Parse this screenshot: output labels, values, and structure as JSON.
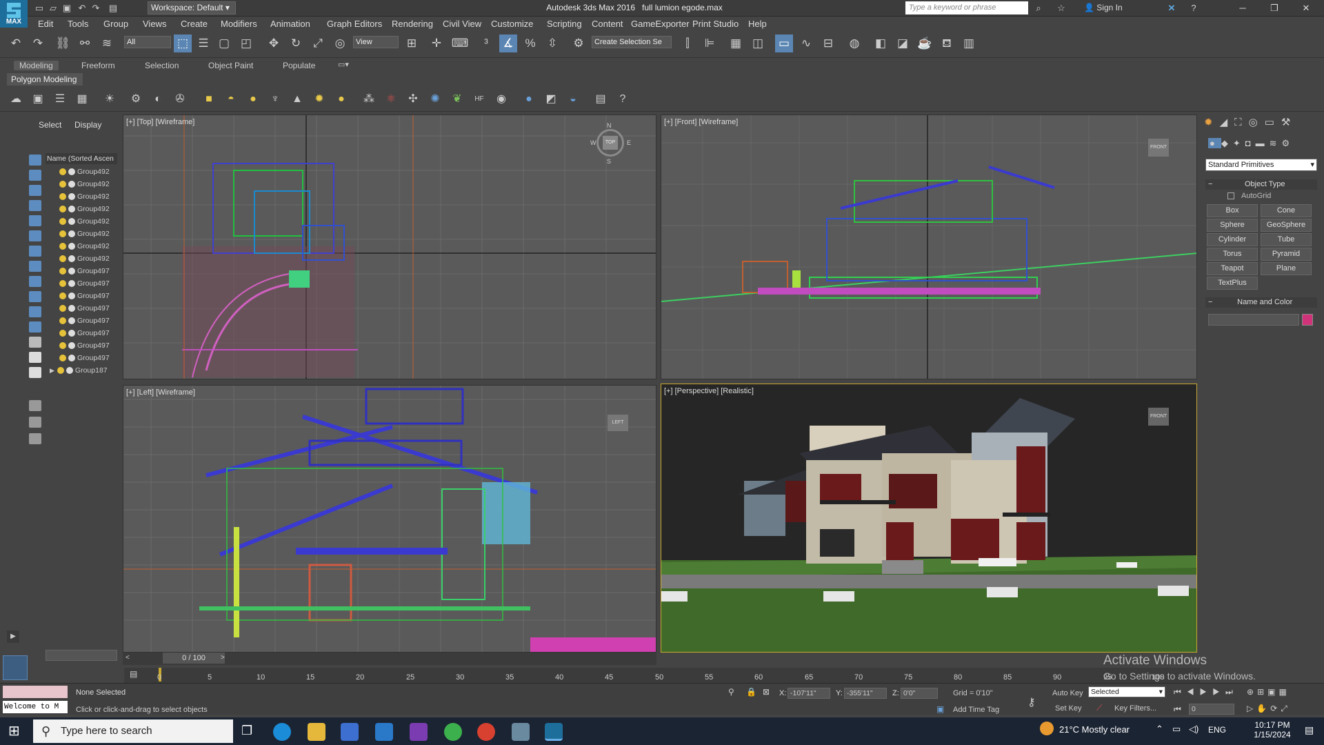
{
  "titlebar": {
    "workspace": "Workspace: Default",
    "app_title": "Autodesk 3ds Max 2016",
    "file_name": "full lumion egode.max",
    "search_placeholder": "Type a keyword or phrase",
    "sign_in": "Sign In",
    "logo_text": "MAX"
  },
  "menu": [
    "Edit",
    "Tools",
    "Group",
    "Views",
    "Create",
    "Modifiers",
    "Animation",
    "Graph Editors",
    "Rendering",
    "Civil View",
    "Customize",
    "Scripting",
    "Content",
    "GameExporter",
    "Print Studio",
    "Help"
  ],
  "main_toolbar": {
    "selection_filter": "All",
    "reference_coord": "View",
    "create_selection_set": "Create Selection Se"
  },
  "ribbon": {
    "tabs": [
      "Modeling",
      "Freeform",
      "Selection",
      "Object Paint",
      "Populate"
    ],
    "active_tab": "Modeling",
    "panel": "Polygon Modeling"
  },
  "scene_explorer": {
    "tabs": [
      "Select",
      "Display"
    ],
    "column": "Name (Sorted Ascen",
    "items": [
      "Group492",
      "Group492",
      "Group492",
      "Group492",
      "Group492",
      "Group492",
      "Group492",
      "Group492",
      "Group497",
      "Group497",
      "Group497",
      "Group497",
      "Group497",
      "Group497",
      "Group497",
      "Group497",
      "Group187"
    ]
  },
  "viewports": {
    "top": "[+] [Top] [Wireframe]",
    "front": "[+] [Front] [Wireframe]",
    "left": "[+] [Left] [Wireframe]",
    "perspective": "[+] [Perspective] [Realistic]",
    "viewcube_top": "TOP",
    "viewcube_front": "FRONT",
    "viewcube_left": "LEFT",
    "compass": [
      "N",
      "E",
      "S",
      "W"
    ]
  },
  "command_panel": {
    "category": "Standard Primitives",
    "object_type": "Object Type",
    "autogrid": "AutoGrid",
    "buttons": [
      "Box",
      "Cone",
      "Sphere",
      "GeoSphere",
      "Cylinder",
      "Tube",
      "Torus",
      "Pyramid",
      "Teapot",
      "Plane",
      "TextPlus"
    ],
    "name_and_color": "Name and Color",
    "color": "#d1337a"
  },
  "timeline": {
    "frame": "0 / 100",
    "ticks": [
      "0",
      "5",
      "10",
      "15",
      "20",
      "25",
      "30",
      "35",
      "40",
      "45",
      "50",
      "55",
      "60",
      "65",
      "70",
      "75",
      "80",
      "85",
      "90",
      "95",
      "100"
    ]
  },
  "status": {
    "welcome": "Welcome to M",
    "selection": "None Selected",
    "prompt": "Click or click-and-drag to select objects",
    "x_label": "X:",
    "x": "-107'11\"",
    "y_label": "Y:",
    "y": "-355'11\"",
    "z_label": "Z:",
    "z": "0'0\"",
    "grid": "Grid = 0'10\"",
    "add_time_tag": "Add Time Tag",
    "auto_key": "Auto Key",
    "set_key": "Set Key",
    "key_mode": "Selected",
    "key_filters": "Key Filters...",
    "frame_field": "0"
  },
  "watermark": {
    "line1": "Activate Windows",
    "line2": "Go to Settings to activate Windows."
  },
  "taskbar": {
    "search": "Type here to search",
    "weather": "21°C  Mostly clear",
    "lang": "ENG",
    "time": "10:17 PM",
    "date": "1/15/2024"
  }
}
